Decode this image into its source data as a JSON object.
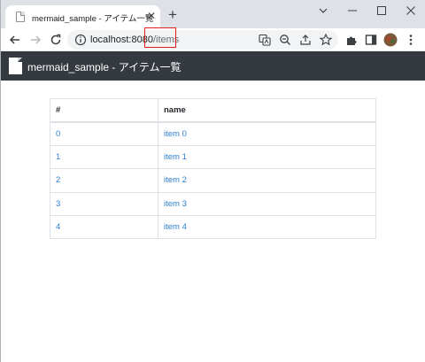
{
  "browser": {
    "tab_title": "mermaid_sample - アイテム一覧",
    "tab_close": "✕",
    "new_tab": "+",
    "url_host": "localhost:8080",
    "url_path": "/items"
  },
  "app": {
    "brand": "mermaid_sample - アイテム一覧"
  },
  "table": {
    "headers": [
      "#",
      "name"
    ],
    "rows": [
      {
        "id": "0",
        "name": "item 0"
      },
      {
        "id": "1",
        "name": "item 1"
      },
      {
        "id": "2",
        "name": "item 2"
      },
      {
        "id": "3",
        "name": "item 3"
      },
      {
        "id": "4",
        "name": "item 4"
      }
    ]
  },
  "colors": {
    "navbar": "#343a40",
    "link": "#2f80d1",
    "highlight": "#e02020"
  }
}
